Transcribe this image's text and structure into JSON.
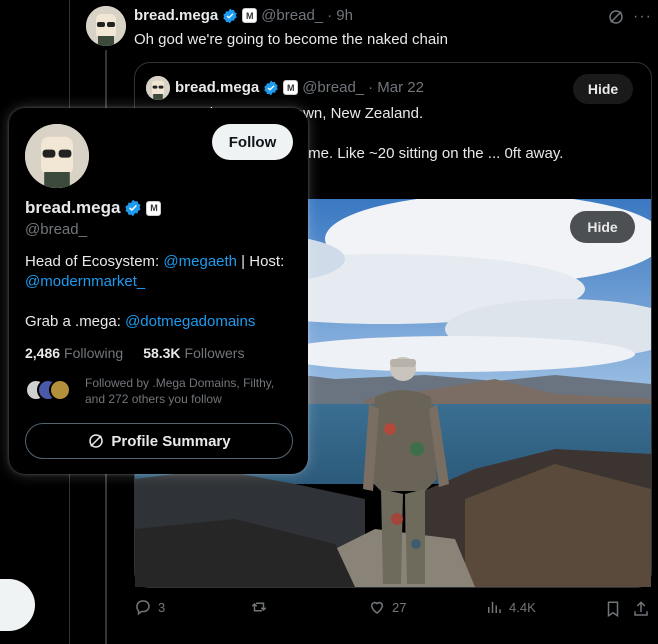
{
  "tweet": {
    "name": "bread.mega",
    "handle": "@bread_",
    "time": "· 9h",
    "text": "Oh god we're going to become the naked chain"
  },
  "quote": {
    "name": "bread.mega",
    "handle": "@bread_",
    "time": "· Mar 22",
    "hide_label": "Hide",
    "line1": "At ... Peak ... Queenstown, New Zealand.",
    "line2": "... ere people could see me. Like ~20 sitting on the ... 0ft away.  x.com/gabrielhaines/..."
  },
  "photo": {
    "hide_label": "Hide"
  },
  "actions": {
    "replies": "3",
    "retweets": "",
    "likes": "27",
    "views": "4.4K"
  },
  "card": {
    "follow_label": "Follow",
    "name": "bread.mega",
    "handle": "@bread_",
    "bio_prefix": "Head of Ecosystem: ",
    "bio_link1": "@megaeth",
    "bio_mid": " | Host: ",
    "bio_link2": "@modernmarket_",
    "bio2_prefix": "Grab a .mega: ",
    "bio2_link": "@dotmegadomains",
    "following_count": "2,486",
    "following_label": "Following",
    "followers_count": "58.3K",
    "followers_label": "Followers",
    "followed_by": "Followed by .Mega Domains, Filthy, and 272 others you follow",
    "summary_label": "Profile Summary"
  },
  "colors": {
    "accent": "#1d9bf0",
    "muted": "#71767b",
    "border": "#2f3336",
    "background": "#000000"
  }
}
